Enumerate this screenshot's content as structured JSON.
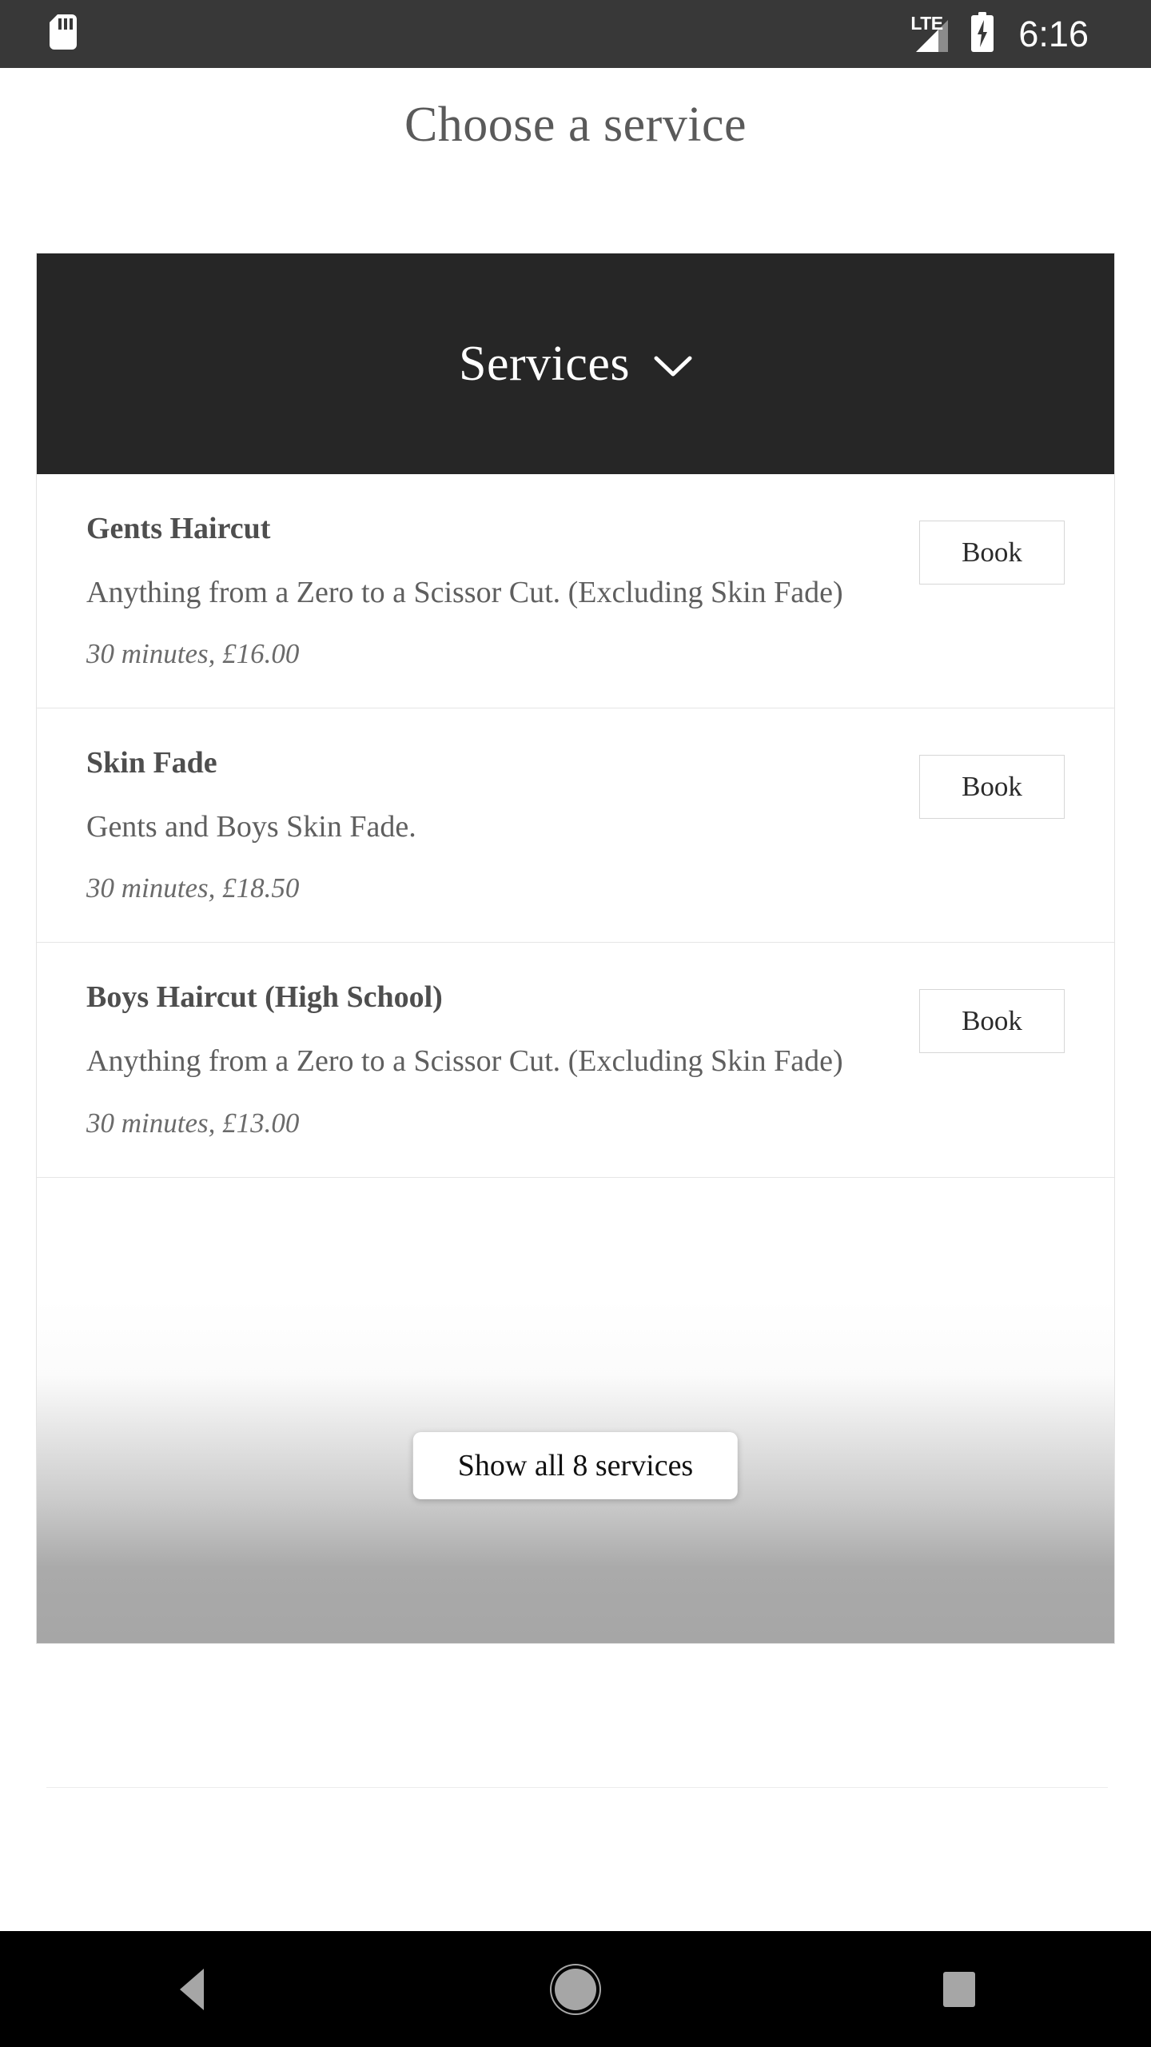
{
  "status_bar": {
    "sim_icon": "sim-card-icon",
    "network_label": "LTE",
    "signal_icon": "signal-bars-icon",
    "battery_icon": "battery-charging-icon",
    "time": "6:16"
  },
  "page": {
    "title": "Choose a service"
  },
  "services_card": {
    "header_title": "Services",
    "header_chevron": "chevron-down-icon",
    "items": [
      {
        "name": "Gents Haircut",
        "description": "Anything from a Zero to a Scissor Cut. (Excluding Skin Fade)",
        "meta": "30 minutes, £16.00",
        "book_label": "Book"
      },
      {
        "name": "Skin Fade",
        "description": "Gents and Boys Skin Fade.",
        "meta": "30 minutes, £18.50",
        "book_label": "Book"
      },
      {
        "name": "Boys Haircut (High School)",
        "description": "Anything from a Zero to a Scissor Cut. (Excluding Skin Fade)",
        "meta": "30 minutes, £13.00",
        "book_label": "Book"
      }
    ],
    "show_all_label": "Show all 8 services"
  },
  "nav_bar": {
    "back_icon": "back-triangle-icon",
    "home_icon": "home-circle-icon",
    "recents_icon": "recents-square-icon"
  },
  "colors": {
    "status_bar_bg": "#383838",
    "header_bg": "#262626",
    "title_text": "#5a5a5a",
    "nav_bar_bg": "#000000",
    "nav_icon": "#a6a6a6"
  }
}
